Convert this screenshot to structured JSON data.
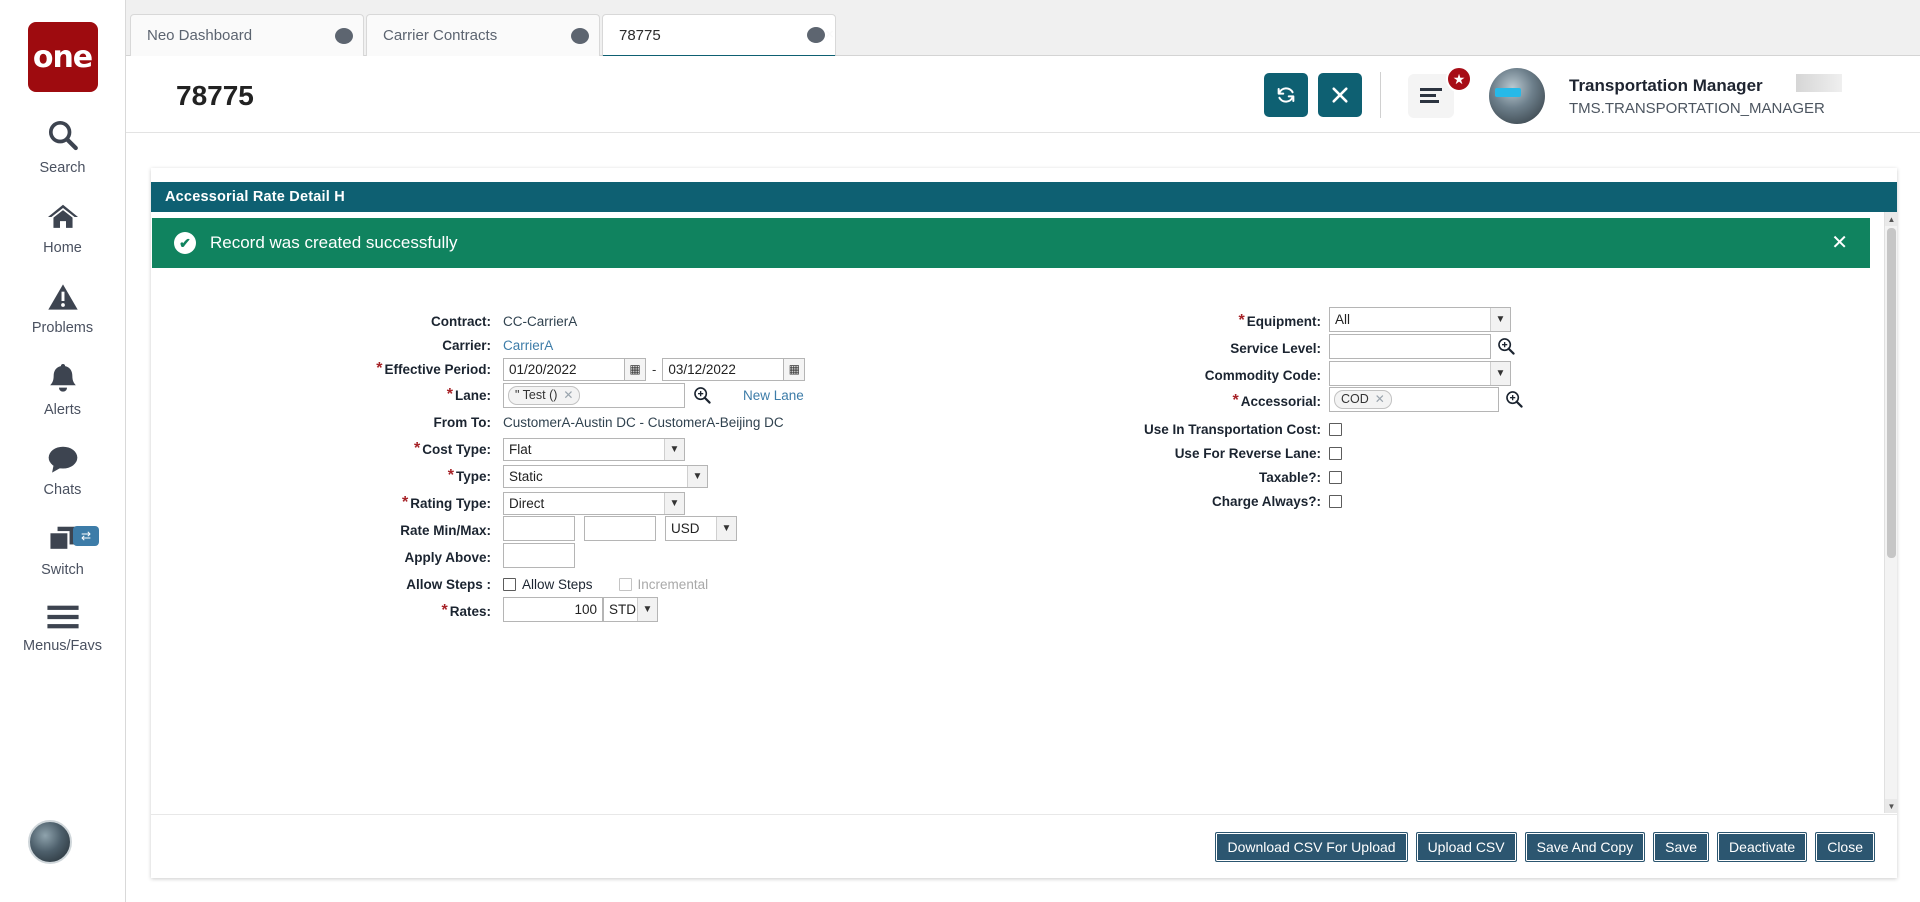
{
  "rail": {
    "logo_text": "one",
    "items": [
      {
        "label": "Search",
        "icon": "search-icon"
      },
      {
        "label": "Home",
        "icon": "home-icon"
      },
      {
        "label": "Problems",
        "icon": "problems-icon"
      },
      {
        "label": "Alerts",
        "icon": "bell-icon"
      },
      {
        "label": "Chats",
        "icon": "chat-icon"
      },
      {
        "label": "Switch",
        "icon": "switch-icon"
      },
      {
        "label": "Menus/Favs",
        "icon": "hamburger-icon"
      }
    ]
  },
  "tabs": [
    {
      "label": "Neo Dashboard",
      "active": false
    },
    {
      "label": "Carrier Contracts",
      "active": false
    },
    {
      "label": "78775",
      "active": true
    }
  ],
  "header": {
    "title": "78775",
    "refresh_label": "⟳",
    "close_label": "✕",
    "menu_badge": "★",
    "user_name": "Transportation Manager",
    "user_role": "TMS.TRANSPORTATION_MANAGER",
    "caret_label": "⌄"
  },
  "card": {
    "header_title": "Accessorial Rate Detail  H",
    "banner": {
      "text": "Record was created successfully",
      "icon": "check-circle-icon",
      "close_label": "✕",
      "color": "#10835f"
    }
  },
  "form": {
    "left": {
      "contract_label": "Contract:",
      "contract_value": "CC-CarrierA",
      "carrier_label": "Carrier:",
      "carrier_value": "CarrierA",
      "effective_period_label": "Effective Period:",
      "effective_from": "01/20/2022",
      "effective_sep": "-",
      "effective_to": "03/12/2022",
      "lane_label": "Lane:",
      "lane_chip": "\" Test ()",
      "new_lane_label": "New Lane",
      "from_to_label": "From To:",
      "from_to_value": "CustomerA-Austin DC - CustomerA-Beijing DC",
      "cost_type_label": "Cost Type:",
      "cost_type_value": "Flat",
      "type_label": "Type:",
      "type_value": "Static",
      "rating_type_label": "Rating Type:",
      "rating_type_value": "Direct",
      "rate_minmax_label": "Rate Min/Max:",
      "rate_min_value": "",
      "rate_max_value": "",
      "currency_value": "USD",
      "apply_above_label": "Apply Above:",
      "apply_above_value": "",
      "allow_steps_label": "Allow Steps :",
      "allow_steps_cb_label": "Allow Steps",
      "incremental_cb_label": "Incremental",
      "rates_label": "Rates:",
      "rates_value": "100",
      "rates_unit": "STD"
    },
    "right": {
      "equipment_label": "Equipment:",
      "equipment_value": "All",
      "service_level_label": "Service Level:",
      "service_level_value": "",
      "commodity_code_label": "Commodity Code:",
      "commodity_code_value": "",
      "accessorial_label": "Accessorial:",
      "accessorial_chip": "COD",
      "use_in_transportation_cost_label": "Use In Transportation Cost:",
      "use_for_reverse_lane_label": "Use For Reverse Lane:",
      "taxable_label": "Taxable?:",
      "charge_always_label": "Charge Always?:"
    }
  },
  "footer": {
    "buttons": [
      "Download CSV For Upload",
      "Upload CSV",
      "Save And Copy",
      "Save",
      "Deactivate",
      "Close"
    ]
  }
}
